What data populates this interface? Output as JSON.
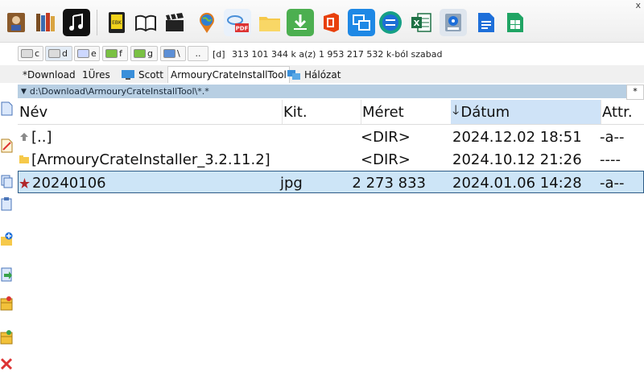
{
  "window": {
    "close_glyph": "x"
  },
  "toolbar": {
    "buttons": [
      {
        "name": "book-person-icon"
      },
      {
        "name": "bookshelf-icon"
      },
      {
        "name": "music-note-icon"
      },
      {
        "name": "ebook-icon"
      },
      {
        "name": "open-book-icon"
      },
      {
        "name": "clapperboard-icon"
      },
      {
        "name": "globe-pin-icon"
      },
      {
        "name": "pdf-icon"
      },
      {
        "name": "folder-icon"
      },
      {
        "name": "download-icon"
      },
      {
        "name": "office-icon"
      },
      {
        "name": "windows-copy-icon"
      },
      {
        "name": "compare-icon"
      },
      {
        "name": "excel-icon"
      },
      {
        "name": "disk-icon"
      },
      {
        "name": "document-blue-icon"
      },
      {
        "name": "spreadsheet-green-icon"
      }
    ],
    "labels": {
      "pdf": "PDF",
      "ebook": "EBK",
      "excel": "X"
    }
  },
  "drivebar": {
    "drives": [
      {
        "letter": "c"
      },
      {
        "letter": "d"
      },
      {
        "letter": "e"
      },
      {
        "letter": "f"
      },
      {
        "letter": "g"
      }
    ],
    "net": "\\",
    "up": "..",
    "current": "[d]",
    "info": "313 101 344 k a(z) 1 953 217 532 k-ból szabad"
  },
  "tabs": [
    {
      "label": "*Download"
    },
    {
      "label": "1Üres"
    },
    {
      "label": "Scott"
    },
    {
      "label": "ArmouryCrateInstallTool"
    },
    {
      "label": "Hálózat"
    }
  ],
  "pathbar": {
    "path": "d:\\Download\\ArmouryCrateInstallTool\\*.*",
    "star": "*"
  },
  "columns": {
    "name": "Név",
    "ext": "Kit.",
    "size": "Méret",
    "date": "Dátum",
    "attr": "Attr."
  },
  "files": [
    {
      "name": "[..]",
      "ext": "",
      "size": "<DIR>",
      "date": "2024.12.02 18:51",
      "attr": "-a--"
    },
    {
      "name": "[ArmouryCrateInstaller_3.2.11.2]",
      "ext": "",
      "size": "<DIR>",
      "date": "2024.10.12 21:26",
      "attr": "----"
    },
    {
      "name": "20240106",
      "ext": "jpg",
      "size": "2 273 833",
      "date": "2024.01.06 14:28",
      "attr": "-a--"
    }
  ],
  "colors": {
    "pathbar": "#b8cfe3",
    "selected_row": "#cde5f7",
    "sorted_header": "#cfe3f7"
  }
}
